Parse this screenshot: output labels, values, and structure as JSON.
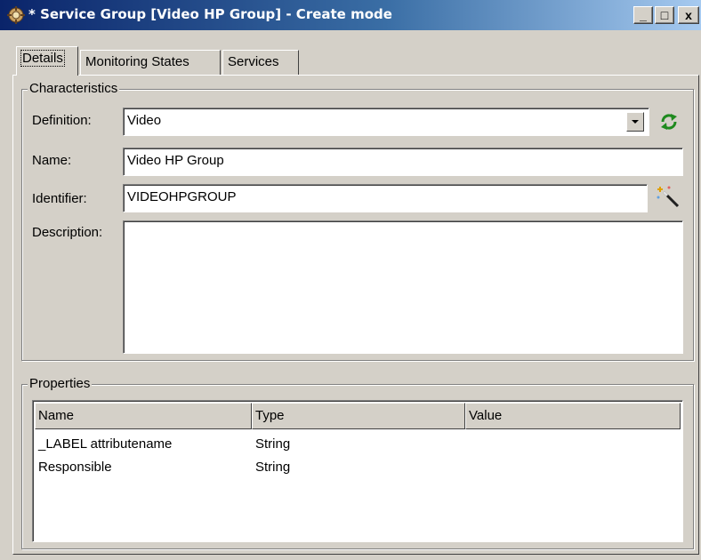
{
  "window": {
    "title": "* Service Group [Video HP Group] - Create mode",
    "buttons": {
      "minimize": "_",
      "maximize": "□",
      "close": "x"
    }
  },
  "tabs": [
    {
      "label": "Details",
      "active": true
    },
    {
      "label": "Monitoring States",
      "active": false
    },
    {
      "label": "Services",
      "active": false
    }
  ],
  "characteristics": {
    "legend": "Characteristics",
    "definition_label": "Definition:",
    "definition_value": "Video",
    "name_label": "Name:",
    "name_value": "Video HP Group",
    "identifier_label": "Identifier:",
    "identifier_value": "VIDEOHPGROUP",
    "description_label": "Description:",
    "description_value": ""
  },
  "properties": {
    "legend": "Properties",
    "columns": [
      "Name",
      "Type",
      "Value"
    ],
    "rows": [
      {
        "name": "_LABEL attributename",
        "type": "String",
        "value": ""
      },
      {
        "name": "Responsible",
        "type": "String",
        "value": ""
      }
    ]
  },
  "icons": {
    "window": "service-group-icon",
    "refresh": "refresh-icon",
    "generate": "magic-wand-icon",
    "dropdown": "chevron-down-icon"
  },
  "colors": {
    "title_start": "#0a246a",
    "title_end": "#a6caf0",
    "face": "#d4d0c8",
    "refresh": "#1e8a1e"
  }
}
